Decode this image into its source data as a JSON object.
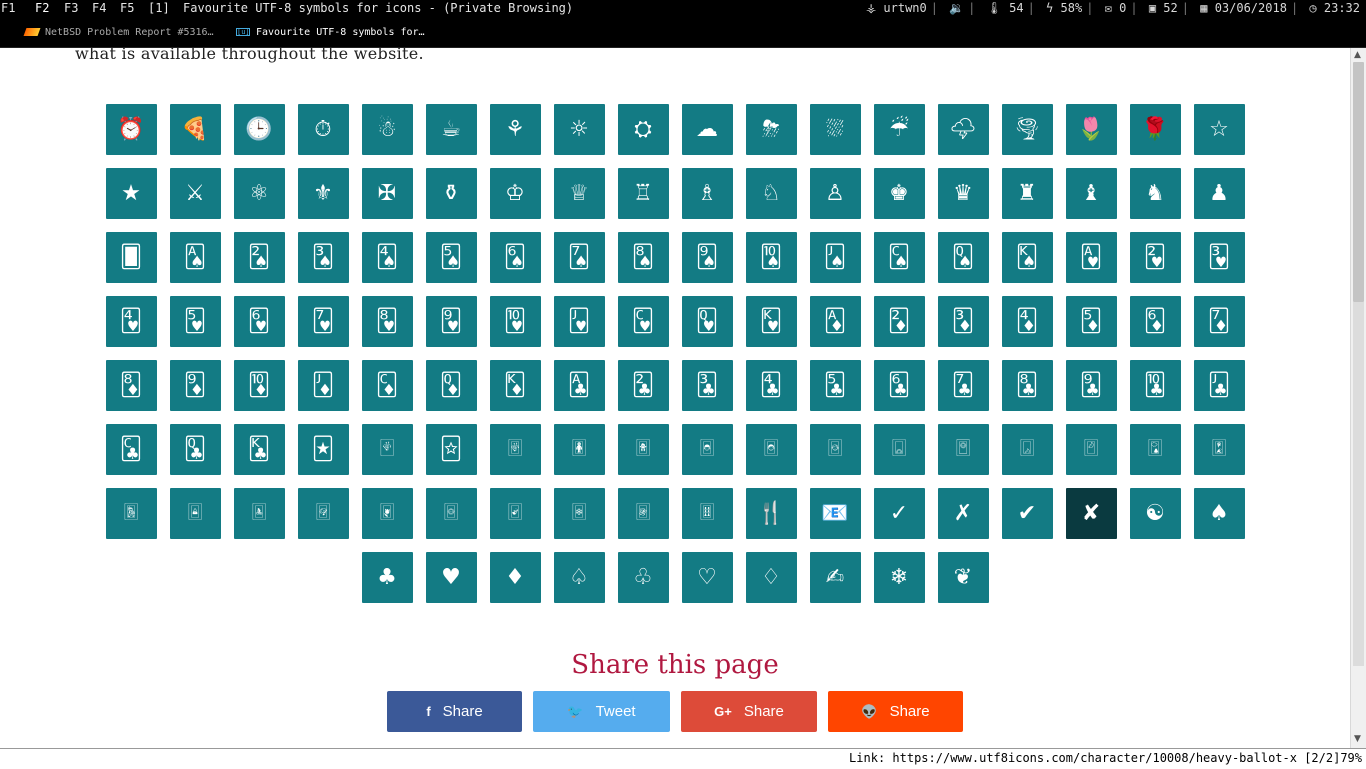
{
  "system_bar": {
    "workspaces": [
      "F1",
      "F2",
      "F3",
      "F4",
      "F5",
      "[1]"
    ],
    "active_workspace": "F2",
    "window_title": "Favourite UTF-8 symbols for icons - (Private Browsing)",
    "status": {
      "network": "urtwn0",
      "volume": "",
      "temperature": "54",
      "battery": "58%",
      "mail": "0",
      "cpu": "52",
      "date": "03/06/2018",
      "time": "23:32"
    }
  },
  "tabs": [
    {
      "label": "NetBSD Problem Report #5316…"
    },
    {
      "label": "Favourite UTF-8 symbols for…"
    }
  ],
  "page": {
    "intro_text": "what is available throughout the website.",
    "symbols": [
      "⏰",
      "🍕",
      "🕒",
      "⏱",
      "☃",
      "☕",
      "⚘",
      "☼",
      "⛭",
      "☁",
      "⛈",
      "⛆",
      "☔",
      "🌩",
      "🌪",
      "🌷",
      "🌹",
      "☆",
      "★",
      "⚔",
      "⚛",
      "⚜",
      "✠",
      "⚱",
      "♔",
      "♕",
      "♖",
      "♗",
      "♘",
      "♙",
      "♚",
      "♛",
      "♜",
      "♝",
      "♞",
      "♟",
      "🂠",
      "🂡",
      "🂢",
      "🂣",
      "🂤",
      "🂥",
      "🂦",
      "🂧",
      "🂨",
      "🂩",
      "🂪",
      "🂫",
      "🂬",
      "🂭",
      "🂮",
      "🂱",
      "🂲",
      "🂳",
      "🂴",
      "🂵",
      "🂶",
      "🂷",
      "🂸",
      "🂹",
      "🂺",
      "🂻",
      "🂼",
      "🂽",
      "🂾",
      "🃁",
      "🃂",
      "🃃",
      "🃄",
      "🃅",
      "🃆",
      "🃇",
      "🃈",
      "🃉",
      "🃊",
      "🃋",
      "🃌",
      "🃍",
      "🃎",
      "🃑",
      "🃒",
      "🃓",
      "🃔",
      "🃕",
      "🃖",
      "🃗",
      "🃘",
      "🃙",
      "🃚",
      "🃛",
      "🃜",
      "🃝",
      "🃞",
      "🃏",
      "🂿",
      "🃟",
      "🃠",
      "🃡",
      "🃢",
      "🃣",
      "🃤",
      "🃥",
      "🃦",
      "🃧",
      "🃨",
      "🃩",
      "🃪",
      "🃫",
      "🃬",
      "🃭",
      "🃮",
      "🃯",
      "🃰",
      "🃱",
      "🃲",
      "🃳",
      "🃴",
      "🃵",
      "🍴",
      "📧",
      "✓",
      "✗",
      "✔",
      "✘",
      "☯",
      "♠",
      "♣",
      "♥",
      "♦",
      "♤",
      "♧",
      "♡",
      "♢",
      "✍",
      "❄",
      "❦"
    ],
    "hovered_symbol_index": 123,
    "share_title": "Share this page",
    "share_buttons": [
      {
        "id": "facebook",
        "icon": "f",
        "label": "Share",
        "color": "#3b5998"
      },
      {
        "id": "twitter",
        "icon": "🐦",
        "label": "Tweet",
        "color": "#55acee"
      },
      {
        "id": "google-plus",
        "icon": "G+",
        "label": "Share",
        "color": "#dd4b39"
      },
      {
        "id": "reddit",
        "icon": "👽",
        "label": "Share",
        "color": "#ff4500"
      }
    ],
    "tile_color": "#137b84",
    "tile_hover_color": "#0a3a40"
  },
  "status_bar": {
    "link_text": "Link: https://www.utf8icons.com/character/10008/heavy-ballot-x [2/2]79%"
  }
}
